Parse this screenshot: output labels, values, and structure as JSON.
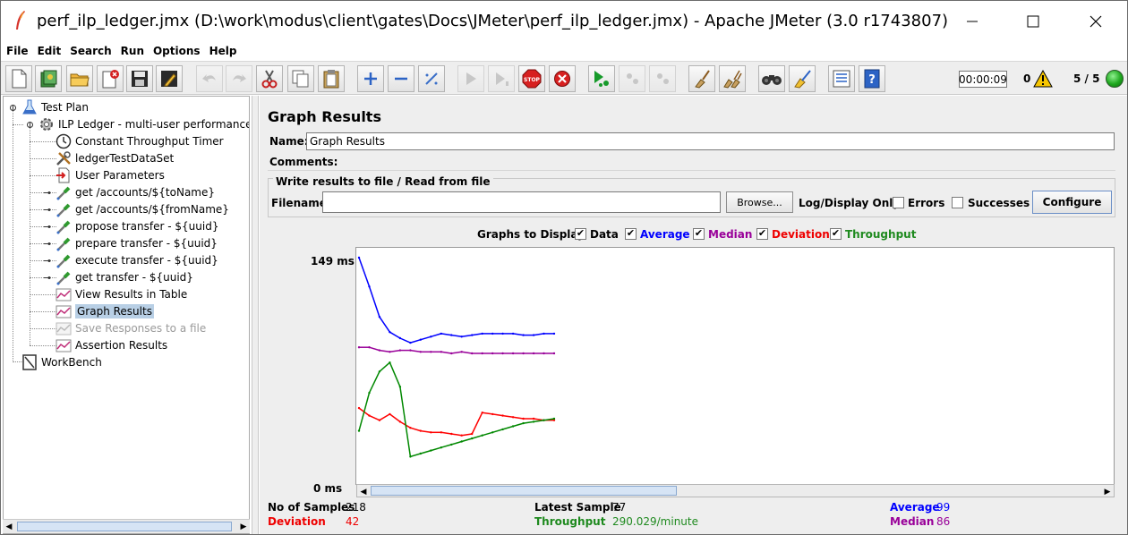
{
  "window": {
    "title": "perf_ilp_ledger.jmx (D:\\work\\modus\\client\\gates\\Docs\\JMeter\\perf_ilp_ledger.jmx) - Apache JMeter (3.0 r1743807)"
  },
  "menu": [
    "File",
    "Edit",
    "Search",
    "Run",
    "Options",
    "Help"
  ],
  "toolbar": {
    "elapsed_time": "00:00:09",
    "error_count": "0",
    "threads": "5 / 5"
  },
  "tree": {
    "items": [
      {
        "label": "Test Plan",
        "icon": "test-plan-icon"
      },
      {
        "label": "ILP Ledger - multi-user performance te",
        "icon": "thread-group-gear-icon"
      },
      {
        "label": "Constant Throughput Timer",
        "icon": "timer-icon"
      },
      {
        "label": "ledgerTestDataSet",
        "icon": "config-tools-icon"
      },
      {
        "label": "User Parameters",
        "icon": "preprocessor-icon"
      },
      {
        "label": "get /accounts/${toName}",
        "icon": "sampler-pipette-icon"
      },
      {
        "label": "get /accounts/${fromName}",
        "icon": "sampler-pipette-icon"
      },
      {
        "label": "propose transfer - ${uuid}",
        "icon": "sampler-pipette-icon"
      },
      {
        "label": "prepare transfer - ${uuid}",
        "icon": "sampler-pipette-icon"
      },
      {
        "label": "execute transfer - ${uuid}",
        "icon": "sampler-pipette-icon"
      },
      {
        "label": "get transfer - ${uuid}",
        "icon": "sampler-pipette-icon"
      },
      {
        "label": "View Results in Table",
        "icon": "listener-graph-icon"
      },
      {
        "label": "Graph Results",
        "icon": "listener-graph-icon"
      },
      {
        "label": "Save Responses to a file",
        "icon": "listener-disabled-icon"
      },
      {
        "label": "Assertion Results",
        "icon": "listener-graph-icon"
      },
      {
        "label": "WorkBench",
        "icon": "workbench-icon"
      }
    ]
  },
  "panel": {
    "title": "Graph Results",
    "name_label": "Name:",
    "name_value": "Graph Results",
    "comments_label": "Comments:",
    "file_group_legend": "Write results to file / Read from file",
    "filename_label": "Filename",
    "filename_value": "",
    "browse_label": "Browse...",
    "log_display_label": "Log/Display Only:",
    "errors_label": "Errors",
    "successes_label": "Successes",
    "configure_label": "Configure",
    "graphs_to_display_label": "Graphs to Display",
    "graph_checks": [
      {
        "label": "Data",
        "color": "#000000",
        "checked": true
      },
      {
        "label": "Average",
        "color": "#0000ff",
        "checked": true
      },
      {
        "label": "Median",
        "color": "#990099",
        "checked": true
      },
      {
        "label": "Deviation",
        "color": "#ff0000",
        "checked": true
      },
      {
        "label": "Throughput",
        "color": "#008800",
        "checked": true
      }
    ],
    "y_max_label": "149  ms",
    "y_min_label": "0  ms"
  },
  "stats": {
    "no_of_samples_label": "No of Samples",
    "no_of_samples_value": "218",
    "latest_sample_label": "Latest Sample",
    "latest_sample_value": "77",
    "average_label": "Average",
    "average_value": "99",
    "deviation_label": "Deviation",
    "deviation_value": "42",
    "throughput_label": "Throughput",
    "throughput_value": "290.029/minute",
    "median_label": "Median",
    "median_value": "86"
  },
  "chart_data": {
    "type": "line",
    "ylim": [
      0,
      149
    ],
    "series": [
      {
        "name": "Average",
        "color": "#0000ff",
        "values": [
          149,
          130,
          110,
          100,
          96,
          93,
          95,
          97,
          99,
          98,
          97,
          98,
          99,
          99,
          99,
          99,
          98,
          98,
          99,
          99
        ]
      },
      {
        "name": "Median",
        "color": "#990099",
        "values": [
          90,
          90,
          88,
          87,
          88,
          88,
          87,
          87,
          87,
          86,
          87,
          86,
          86,
          86,
          86,
          86,
          86,
          86,
          86,
          86
        ]
      },
      {
        "name": "Deviation",
        "color": "#ff0000",
        "values": [
          50,
          45,
          42,
          46,
          41,
          37,
          35,
          34,
          34,
          33,
          32,
          33,
          47,
          46,
          45,
          44,
          43,
          43,
          42,
          42
        ]
      },
      {
        "name": "Throughput",
        "color": "#008800",
        "values": [
          35,
          60,
          74,
          80,
          64,
          18,
          20,
          22,
          24,
          26,
          28,
          30,
          32,
          34,
          36,
          38,
          40,
          41,
          42,
          43
        ]
      }
    ]
  }
}
